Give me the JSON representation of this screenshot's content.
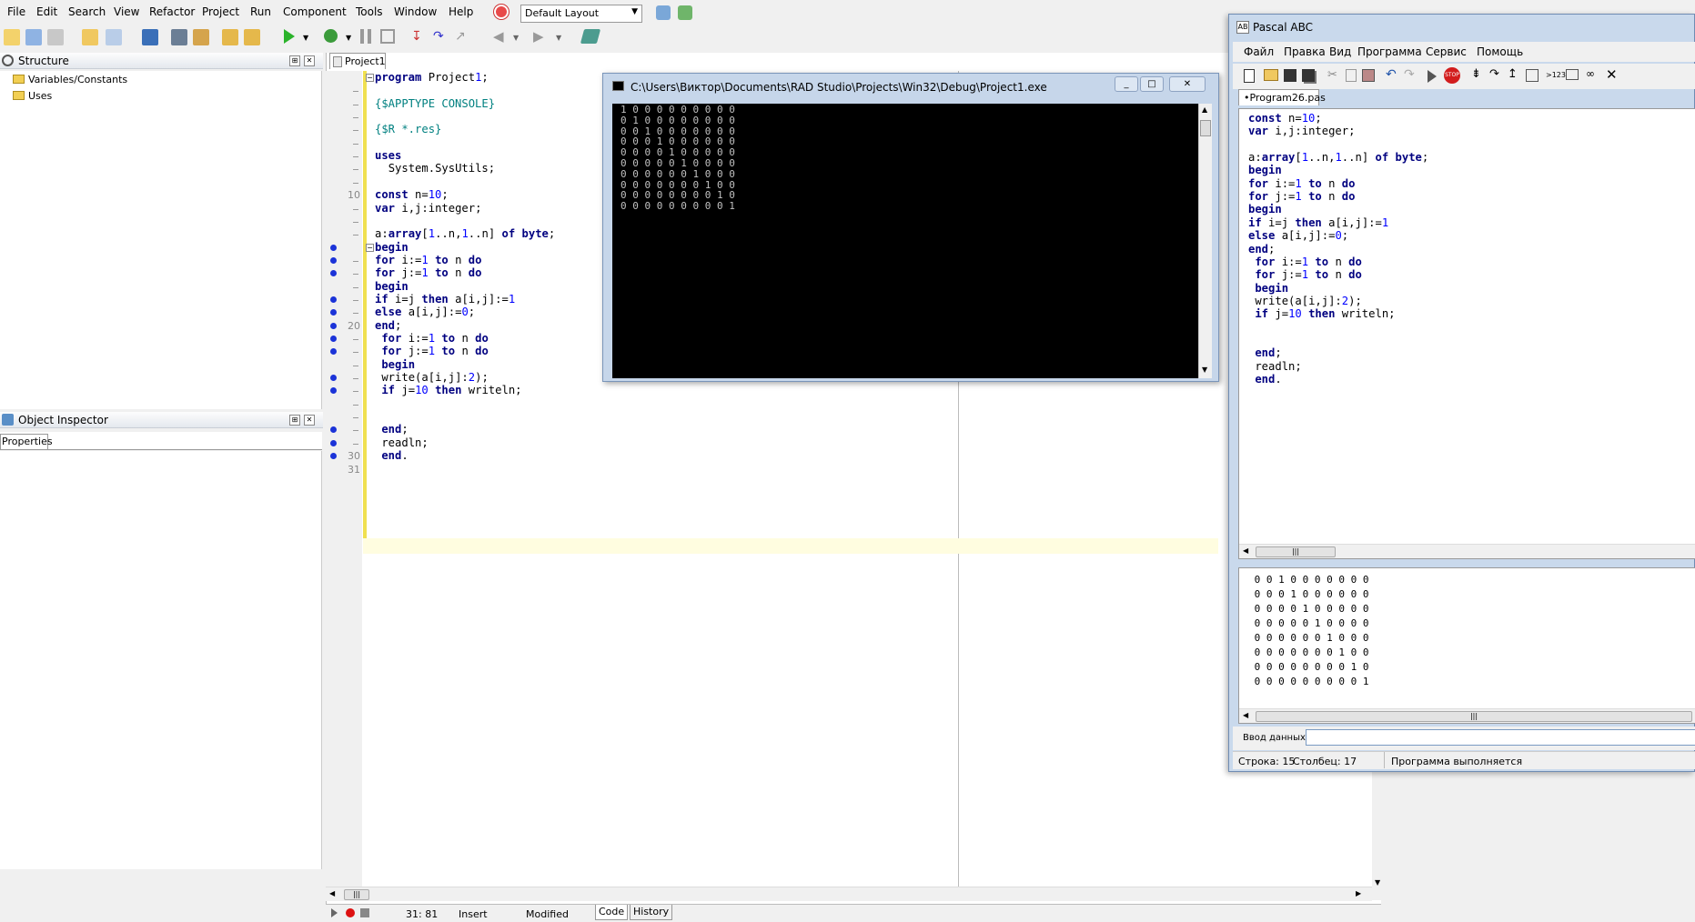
{
  "ide": {
    "menu": [
      "File",
      "Edit",
      "Search",
      "View",
      "Refactor",
      "Project",
      "Run",
      "Component",
      "Tools",
      "Window",
      "Help"
    ],
    "layout": "Default Layout",
    "structure": {
      "title": "Structure",
      "items": [
        "Variables/Constants",
        "Uses"
      ]
    },
    "inspector": {
      "title": "Object Inspector",
      "tab": "Properties"
    },
    "editor_tab": "Project1",
    "gutter_numbers": [
      "10",
      "20",
      "30",
      "31"
    ],
    "code_lines": [
      "program Project1;",
      "",
      "{$APPTYPE CONSOLE}",
      "",
      "{$R *.res}",
      "",
      "uses",
      "  System.SysUtils;",
      "",
      "const n=10;",
      "var i,j:integer;",
      "",
      "a:array[1..n,1..n] of byte;",
      "begin",
      "for i:=1 to n do",
      "for j:=1 to n do",
      "begin",
      "if i=j then a[i,j]:=1",
      "else a[i,j]:=0;",
      "end;",
      " for i:=1 to n do",
      " for j:=1 to n do",
      " begin",
      " write(a[i,j]:2);",
      " if j=10 then writeln;",
      "",
      "",
      " end;",
      " readln;",
      " end.",
      ""
    ],
    "status": {
      "position": "31: 81",
      "mode": "Insert",
      "modified": "Modified",
      "tab_code": "Code",
      "tab_history": "History"
    }
  },
  "console": {
    "title": "C:\\Users\\Виктор\\Documents\\RAD Studio\\Projects\\Win32\\Debug\\Project1.exe",
    "output": "1 0 0 0 0 0 0 0 0 0\n0 1 0 0 0 0 0 0 0 0\n0 0 1 0 0 0 0 0 0 0\n0 0 0 1 0 0 0 0 0 0\n0 0 0 0 1 0 0 0 0 0\n0 0 0 0 0 1 0 0 0 0\n0 0 0 0 0 0 1 0 0 0\n0 0 0 0 0 0 0 1 0 0\n0 0 0 0 0 0 0 0 1 0\n0 0 0 0 0 0 0 0 0 1"
  },
  "pascal_abc": {
    "title": "Pascal ABC",
    "menu": [
      "Файл",
      "Правка",
      "Вид",
      "Программа",
      "Сервис",
      "Помощь"
    ],
    "file_tab": "•Program26.pas",
    "code_lines": [
      "const n=10;",
      "var i,j:integer;",
      "",
      "a:array[1..n,1..n] of byte;",
      "begin",
      "for i:=1 to n do",
      "for j:=1 to n do",
      "begin",
      "if i=j then a[i,j]:=1",
      "else a[i,j]:=0;",
      "end;",
      " for i:=1 to n do",
      " for j:=1 to n do",
      " begin",
      " write(a[i,j]:2);",
      " if j=10 then writeln;",
      "",
      "",
      " end;",
      " readln;",
      " end."
    ],
    "output": " 0 0 1 0 0 0 0 0 0 0\n 0 0 0 1 0 0 0 0 0 0\n 0 0 0 0 1 0 0 0 0 0\n 0 0 0 0 0 1 0 0 0 0\n 0 0 0 0 0 0 1 0 0 0\n 0 0 0 0 0 0 0 1 0 0\n 0 0 0 0 0 0 0 0 1 0\n 0 0 0 0 0 0 0 0 0 1",
    "input_label": "Ввод данных:",
    "status_row": "Строка: 15",
    "status_col": "Столбец: 17",
    "status_msg": "Программа выполняется"
  }
}
